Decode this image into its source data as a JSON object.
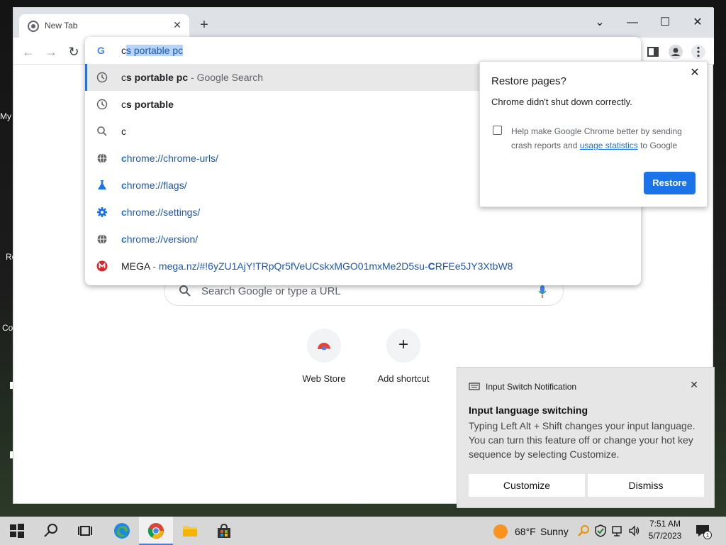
{
  "desktop": {
    "icon_labels": [
      "My",
      "Re",
      "Co"
    ]
  },
  "browser": {
    "tab": {
      "title": "New Tab"
    },
    "omnibox": {
      "typed": "c",
      "selected_completion": "s portable pc",
      "suggestions": [
        {
          "prefix": "c",
          "bold": "s portable pc",
          "suffix": " - Google Search",
          "icon": "history-icon"
        },
        {
          "prefix": "c",
          "bold": "s portable",
          "suffix": "",
          "icon": "history-icon"
        },
        {
          "prefix": "c",
          "bold": "",
          "suffix": "",
          "icon": "search-icon"
        },
        {
          "prefix": "c",
          "bold": "",
          "suffix": "hrome://chrome-urls/",
          "icon": "globe-icon"
        },
        {
          "prefix": "c",
          "bold": "",
          "suffix": "hrome://flags/",
          "icon": "flask-icon"
        },
        {
          "prefix": "c",
          "bold": "",
          "suffix": "hrome://settings/",
          "icon": "gear-icon"
        },
        {
          "prefix": "c",
          "bold": "",
          "suffix": "hrome://version/",
          "icon": "globe-icon"
        }
      ],
      "mega": {
        "title": "MEGA",
        "separator": " - ",
        "url_part1": "mega.nz/#!6yZU1AjY!TRpQr5fVeUCskxMGO01mxMe2D5su-",
        "url_match": "C",
        "url_part2": "RFEe5JY3XtbW8"
      }
    },
    "ntp": {
      "search_placeholder": "Search Google or type a URL",
      "shortcuts": [
        {
          "label": "Web Store"
        },
        {
          "label": "Add shortcut"
        }
      ]
    },
    "restore_bubble": {
      "title": "Restore pages?",
      "message": "Chrome didn't shut down correctly.",
      "checkbox_text_1": "Help make Google Chrome better by sending crash reports and ",
      "checkbox_link": "usage statistics",
      "checkbox_text_2": " to Google",
      "checked": false,
      "button": "Restore"
    }
  },
  "notification": {
    "app": "Input Switch Notification",
    "title": "Input language switching",
    "body": "Typing Left Alt + Shift changes your input language. You can turn this feature off or change your hot key sequence by selecting Customize.",
    "buttons": [
      "Customize",
      "Dismiss"
    ]
  },
  "taskbar": {
    "weather_temp": "68°F",
    "weather_condition": "Sunny",
    "time": "7:51 AM",
    "date": "5/7/2023",
    "notification_count": "1"
  },
  "colors": {
    "accent": "#1a73e8",
    "selection": "#b6d4f8",
    "mega_red": "#d9272e"
  }
}
